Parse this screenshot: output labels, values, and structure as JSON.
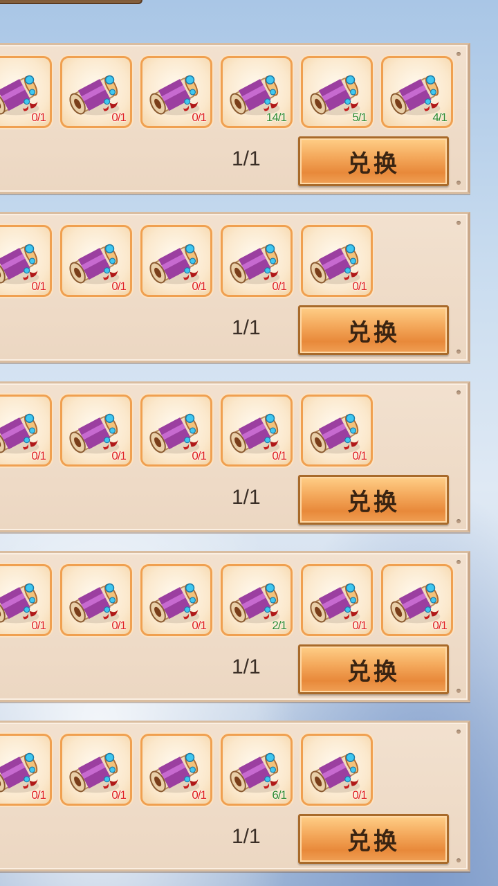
{
  "exchange_rows": [
    {
      "items": [
        {
          "icon": "scroll-item-icon",
          "count": "0/1",
          "status": "red"
        },
        {
          "icon": "scroll-item-icon",
          "count": "0/1",
          "status": "red"
        },
        {
          "icon": "scroll-item-icon",
          "count": "0/1",
          "status": "red"
        },
        {
          "icon": "scroll-item-icon",
          "count": "14/1",
          "status": "green"
        },
        {
          "icon": "scroll-item-icon",
          "count": "5/1",
          "status": "green"
        },
        {
          "icon": "scroll-item-icon",
          "count": "4/1",
          "status": "green"
        }
      ],
      "limit": "1/1",
      "button_label": "兑换"
    },
    {
      "items": [
        {
          "icon": "scroll-item-icon",
          "count": "0/1",
          "status": "red"
        },
        {
          "icon": "scroll-item-icon",
          "count": "0/1",
          "status": "red"
        },
        {
          "icon": "scroll-item-icon",
          "count": "0/1",
          "status": "red"
        },
        {
          "icon": "scroll-item-icon",
          "count": "0/1",
          "status": "red"
        },
        {
          "icon": "scroll-item-icon",
          "count": "0/1",
          "status": "red"
        }
      ],
      "limit": "1/1",
      "button_label": "兑换"
    },
    {
      "items": [
        {
          "icon": "scroll-item-icon",
          "count": "0/1",
          "status": "red"
        },
        {
          "icon": "scroll-item-icon",
          "count": "0/1",
          "status": "red"
        },
        {
          "icon": "scroll-item-icon",
          "count": "0/1",
          "status": "red"
        },
        {
          "icon": "scroll-item-icon",
          "count": "0/1",
          "status": "red"
        },
        {
          "icon": "scroll-item-icon",
          "count": "0/1",
          "status": "red"
        }
      ],
      "limit": "1/1",
      "button_label": "兑换"
    },
    {
      "items": [
        {
          "icon": "scroll-item-icon",
          "count": "0/1",
          "status": "red"
        },
        {
          "icon": "scroll-item-icon",
          "count": "0/1",
          "status": "red"
        },
        {
          "icon": "scroll-item-icon",
          "count": "0/1",
          "status": "red"
        },
        {
          "icon": "scroll-item-icon",
          "count": "2/1",
          "status": "green"
        },
        {
          "icon": "scroll-item-icon",
          "count": "0/1",
          "status": "red"
        },
        {
          "icon": "scroll-item-icon",
          "count": "0/1",
          "status": "red"
        }
      ],
      "limit": "1/1",
      "button_label": "兑换"
    },
    {
      "items": [
        {
          "icon": "scroll-item-icon",
          "count": "0/1",
          "status": "red"
        },
        {
          "icon": "scroll-item-icon",
          "count": "0/1",
          "status": "red"
        },
        {
          "icon": "scroll-item-icon",
          "count": "0/1",
          "status": "red"
        },
        {
          "icon": "scroll-item-icon",
          "count": "6/1",
          "status": "green"
        },
        {
          "icon": "scroll-item-icon",
          "count": "0/1",
          "status": "red"
        }
      ],
      "limit": "1/1",
      "button_label": "兑换"
    }
  ],
  "colors": {
    "count_insufficient": "#e02020",
    "count_sufficient": "#2f8a2f",
    "button_orange": "#e8893a",
    "slot_border": "#f0a050"
  }
}
